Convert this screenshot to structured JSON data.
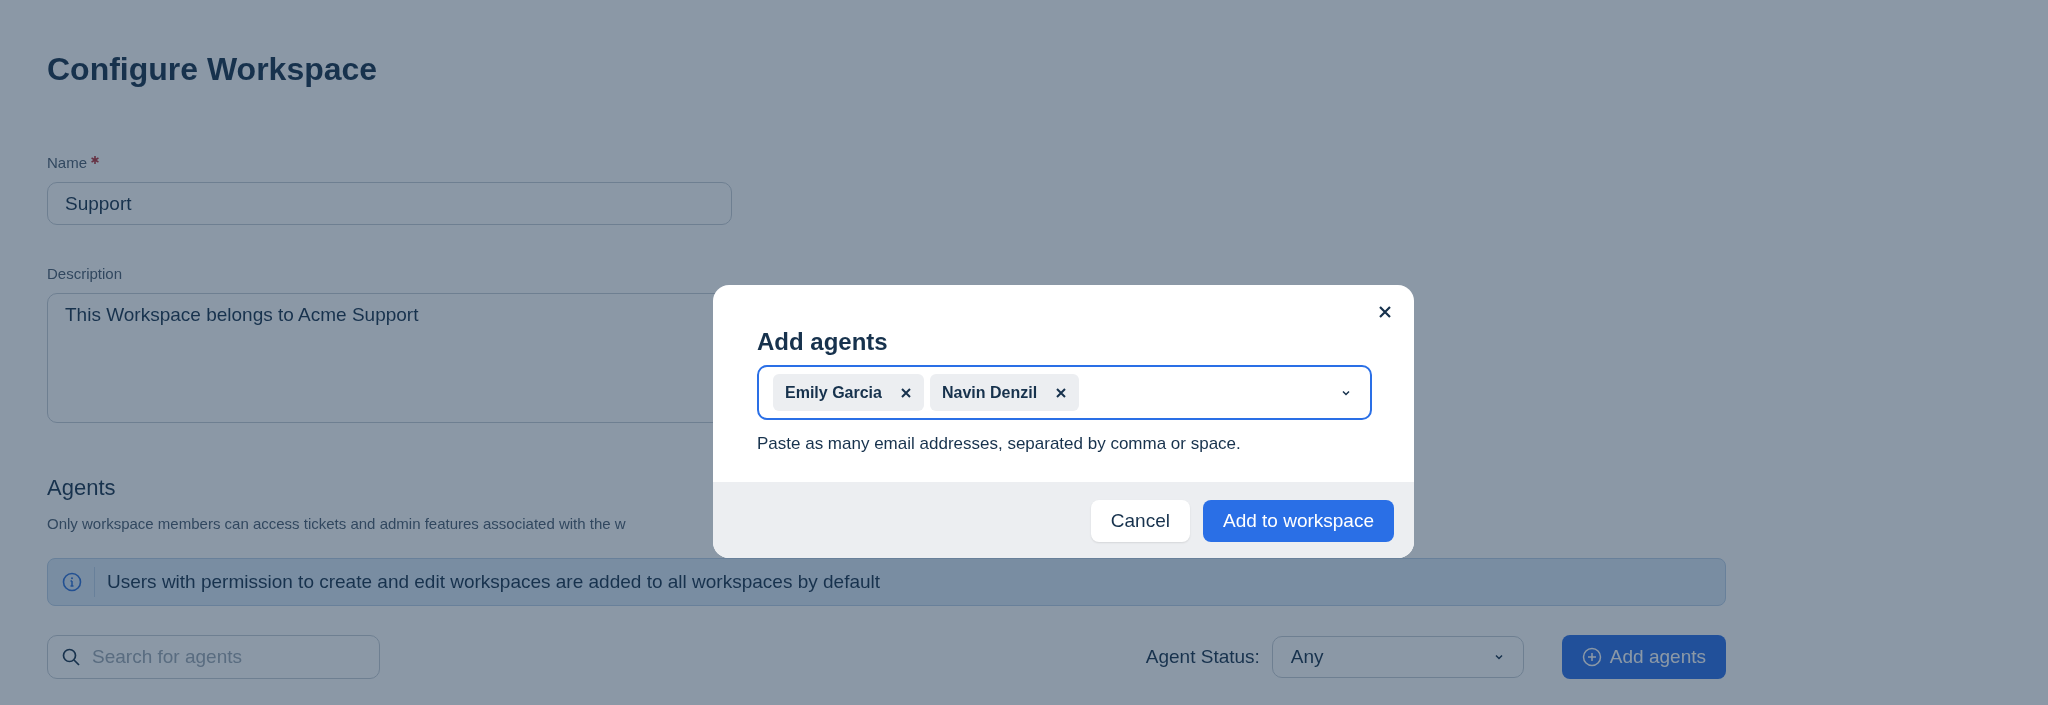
{
  "page": {
    "title": "Configure Workspace",
    "name_field": {
      "label": "Name",
      "required": true,
      "value": "Support"
    },
    "description_field": {
      "label": "Description",
      "value": "This Workspace belongs to Acme Support"
    },
    "agents": {
      "heading": "Agents",
      "description": "Only workspace members can access tickets and admin features associated with the w",
      "info": "Users with permission to create and edit workspaces are added to all workspaces by default",
      "search": {
        "placeholder": "Search for agents"
      },
      "status_filter": {
        "label": "Agent Status:",
        "value": "Any"
      },
      "add_button": "Add agents"
    }
  },
  "dialog": {
    "title": "Add agents",
    "chips": [
      {
        "label": "Emily Garcia"
      },
      {
        "label": "Navin Denzil"
      }
    ],
    "hint": "Paste as many email addresses, separated by comma or space.",
    "buttons": [
      {
        "label": "Cancel",
        "kind": "secondary"
      },
      {
        "label": "Add to workspace",
        "kind": "primary"
      }
    ]
  }
}
